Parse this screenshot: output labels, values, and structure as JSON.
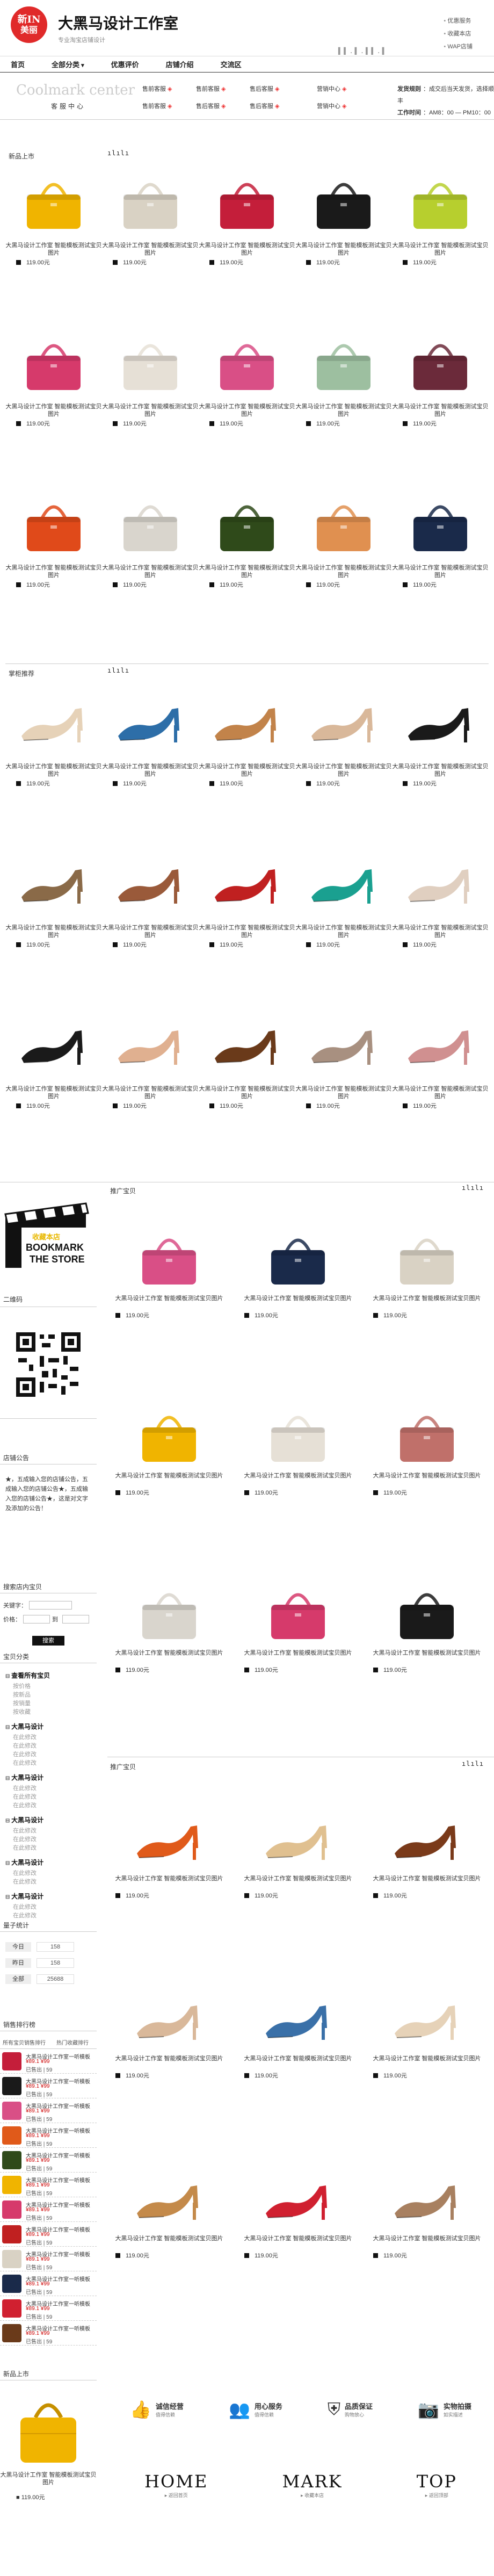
{
  "header": {
    "logo_line1": "新IN",
    "logo_line2": "美丽",
    "shop_name": "大黑马设计工作室",
    "shop_sub": "专业淘宝店铺设计",
    "links": [
      "优惠服务",
      "收藏本店",
      "WAP店铺"
    ],
    "deco": "▌▌.▌.▌▌.▌"
  },
  "nav": [
    "首页",
    "全部分类",
    "优惠评价",
    "店铺介绍",
    "交流区"
  ],
  "info": {
    "cc_text": "Coolmark center",
    "cc_sub": "客服中心",
    "svc_col1": [
      "售前客服",
      "售前客服"
    ],
    "svc_col2": [
      "售前客服",
      "售后客服"
    ],
    "svc_col3": [
      "售后客服",
      "售后客服"
    ],
    "svc_col4": [
      "营销中心",
      "营销中心"
    ],
    "hours_label1": "发货规则",
    "hours_val1": "：成交后当天发货，选择顺丰",
    "hours_label2": "工作时间",
    "hours_val2": "：AM8：00 — PM10：00"
  },
  "sections": {
    "new_arrivals": "新品上市",
    "shoes": "掌柜推荐",
    "recommend1": "推广宝贝",
    "recommend2": "推广宝贝",
    "bars": "ılılı"
  },
  "product": {
    "desc": "大黑马设计工作室 智能模板测试宝贝图片",
    "price": "119.00元"
  },
  "sidebar": {
    "bookmark_cn": "收藏本店",
    "bookmark_en1": "BOOKMARK",
    "bookmark_en2": "THE STORE",
    "qr_title": "二维码",
    "notice_title": "店铺公告",
    "notice_text": "★，五成输入您的店铺公告，五成输入您的店铺公告★，五成输入您的店铺公告★，这是对文字及添加的公告！",
    "search_title": "搜索店内宝贝",
    "search_kw_label": "关键字：",
    "search_price_label": "价格：",
    "search_price_sep": "到",
    "search_btn": "搜索",
    "cats_title": "宝贝分类",
    "cats": [
      {
        "title": "查看所有宝贝",
        "items": [
          "按价格",
          "按新品",
          "按销量",
          "按收藏"
        ]
      },
      {
        "title": "大黑马设计",
        "items": [
          "在此修改",
          "在此修改",
          "在此修改",
          "在此修改"
        ]
      },
      {
        "title": "大黑马设计",
        "items": [
          "在此修改",
          "在此修改",
          "在此修改"
        ]
      },
      {
        "title": "大黑马设计",
        "items": [
          "在此修改",
          "在此修改",
          "在此修改"
        ]
      },
      {
        "title": "大黑马设计",
        "items": [
          "在此修改",
          "在此修改"
        ]
      },
      {
        "title": "大黑马设计",
        "items": [
          "在此修改",
          "在此修改"
        ]
      }
    ],
    "stats_title": "量子统计",
    "stats": [
      {
        "label": "今日",
        "value": "158"
      },
      {
        "label": "昨日",
        "value": "158"
      },
      {
        "label": "全部",
        "value": "25688"
      }
    ],
    "rank_title": "销售排行榜",
    "rank_tabs": [
      "所有宝贝销售排行",
      "热门收藏排行"
    ],
    "rank_item_title": "大黑马设计工作室一听模板",
    "rank_item_price": "¥89.1 ¥99",
    "rank_item_sold": "已售出 | 59",
    "bottom_new": "新品上市",
    "bottom_desc": "大黑马设计工作室 智能模板测试宝贝图片",
    "bottom_price": "119.00元"
  },
  "footer": {
    "features": [
      {
        "t1": "诚信经营",
        "t2": "值得信赖"
      },
      {
        "t1": "用心服务",
        "t2": "值得信赖"
      },
      {
        "t1": "品质保证",
        "t2": "购物放心"
      },
      {
        "t1": "实物拍摄",
        "t2": "如实描述"
      }
    ],
    "nav": [
      {
        "big": "HOME",
        "small": "▸ 返回首页"
      },
      {
        "big": "MARK",
        "small": "▸ 收藏本店"
      },
      {
        "big": "TOP",
        "small": "▸ 返回顶部"
      }
    ]
  },
  "colors": {
    "bags": [
      "#f0b400",
      "#d9d2c4",
      "#c41e3a",
      "#1a1a1a",
      "#b7cf2e",
      "#d63a6b",
      "#e6e0d6",
      "#d94f86",
      "#9dbfa0",
      "#6b2a3a",
      "#e04a1a",
      "#d9d5cd",
      "#2f4a1a",
      "#e09050",
      "#1a2a4a"
    ],
    "shoes": [
      "#e6d2b8",
      "#2d6ea8",
      "#c2834a",
      "#d9b89a",
      "#1a1a1a",
      "#8a6a48",
      "#9a5a3a",
      "#c02020",
      "#1aa090",
      "#e0cfc0",
      "#1a1a1a",
      "#e0b090",
      "#6a3a1a",
      "#a89080",
      "#d09090"
    ],
    "rec_bags": [
      "#d94f86",
      "#1a2a4a",
      "#d9d2c4",
      "#f0b400",
      "#e6e0d6",
      "#c0706a",
      "#d9d5cd",
      "#d63a6b",
      "#1a1a1a"
    ],
    "rec_shoes": [
      "#e05a1a",
      "#e0c090",
      "#7a3a1a",
      "#d9b89a",
      "#3a70a8",
      "#e6d2b8",
      "#c48a4a",
      "#d02030",
      "#a88060"
    ]
  }
}
